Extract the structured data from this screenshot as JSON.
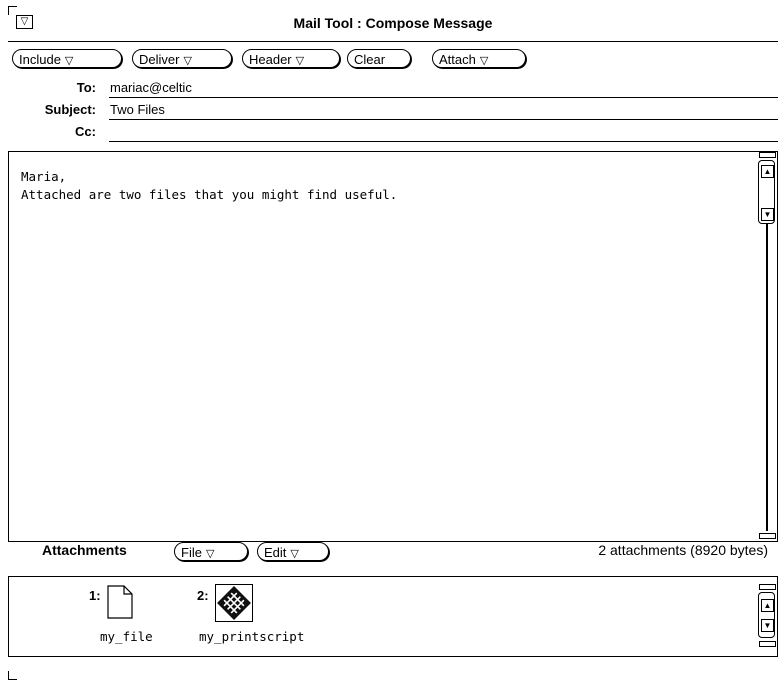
{
  "window": {
    "title": "Mail Tool : Compose Message",
    "menu_glyph": "▽"
  },
  "toolbar": {
    "include_label": "Include",
    "deliver_label": "Deliver",
    "header_label": "Header",
    "clear_label": "Clear",
    "attach_label": "Attach",
    "menu_glyph": "▽"
  },
  "header": {
    "to_label": "To:",
    "to_value": "mariac@celtic",
    "subject_label": "Subject:",
    "subject_value": "Two Files",
    "cc_label": "Cc:",
    "cc_value": ""
  },
  "message": {
    "lines": [
      "Maria,",
      "Attached are two files that you might find useful."
    ]
  },
  "attachments": {
    "label": "Attachments",
    "file_label": "File",
    "edit_label": "Edit",
    "summary": "2 attachments (8920 bytes)",
    "items": [
      {
        "number": "1:",
        "name": "my_file",
        "icon": "document-icon"
      },
      {
        "number": "2:",
        "name": "my_printscript",
        "icon": "postscript-icon"
      }
    ]
  },
  "icons": {
    "window_menu": "window-menu-icon",
    "menu_triangle": "menu-triangle-icon",
    "scroll_up": "scroll-up-arrow-icon",
    "scroll_down": "scroll-down-arrow-icon"
  }
}
